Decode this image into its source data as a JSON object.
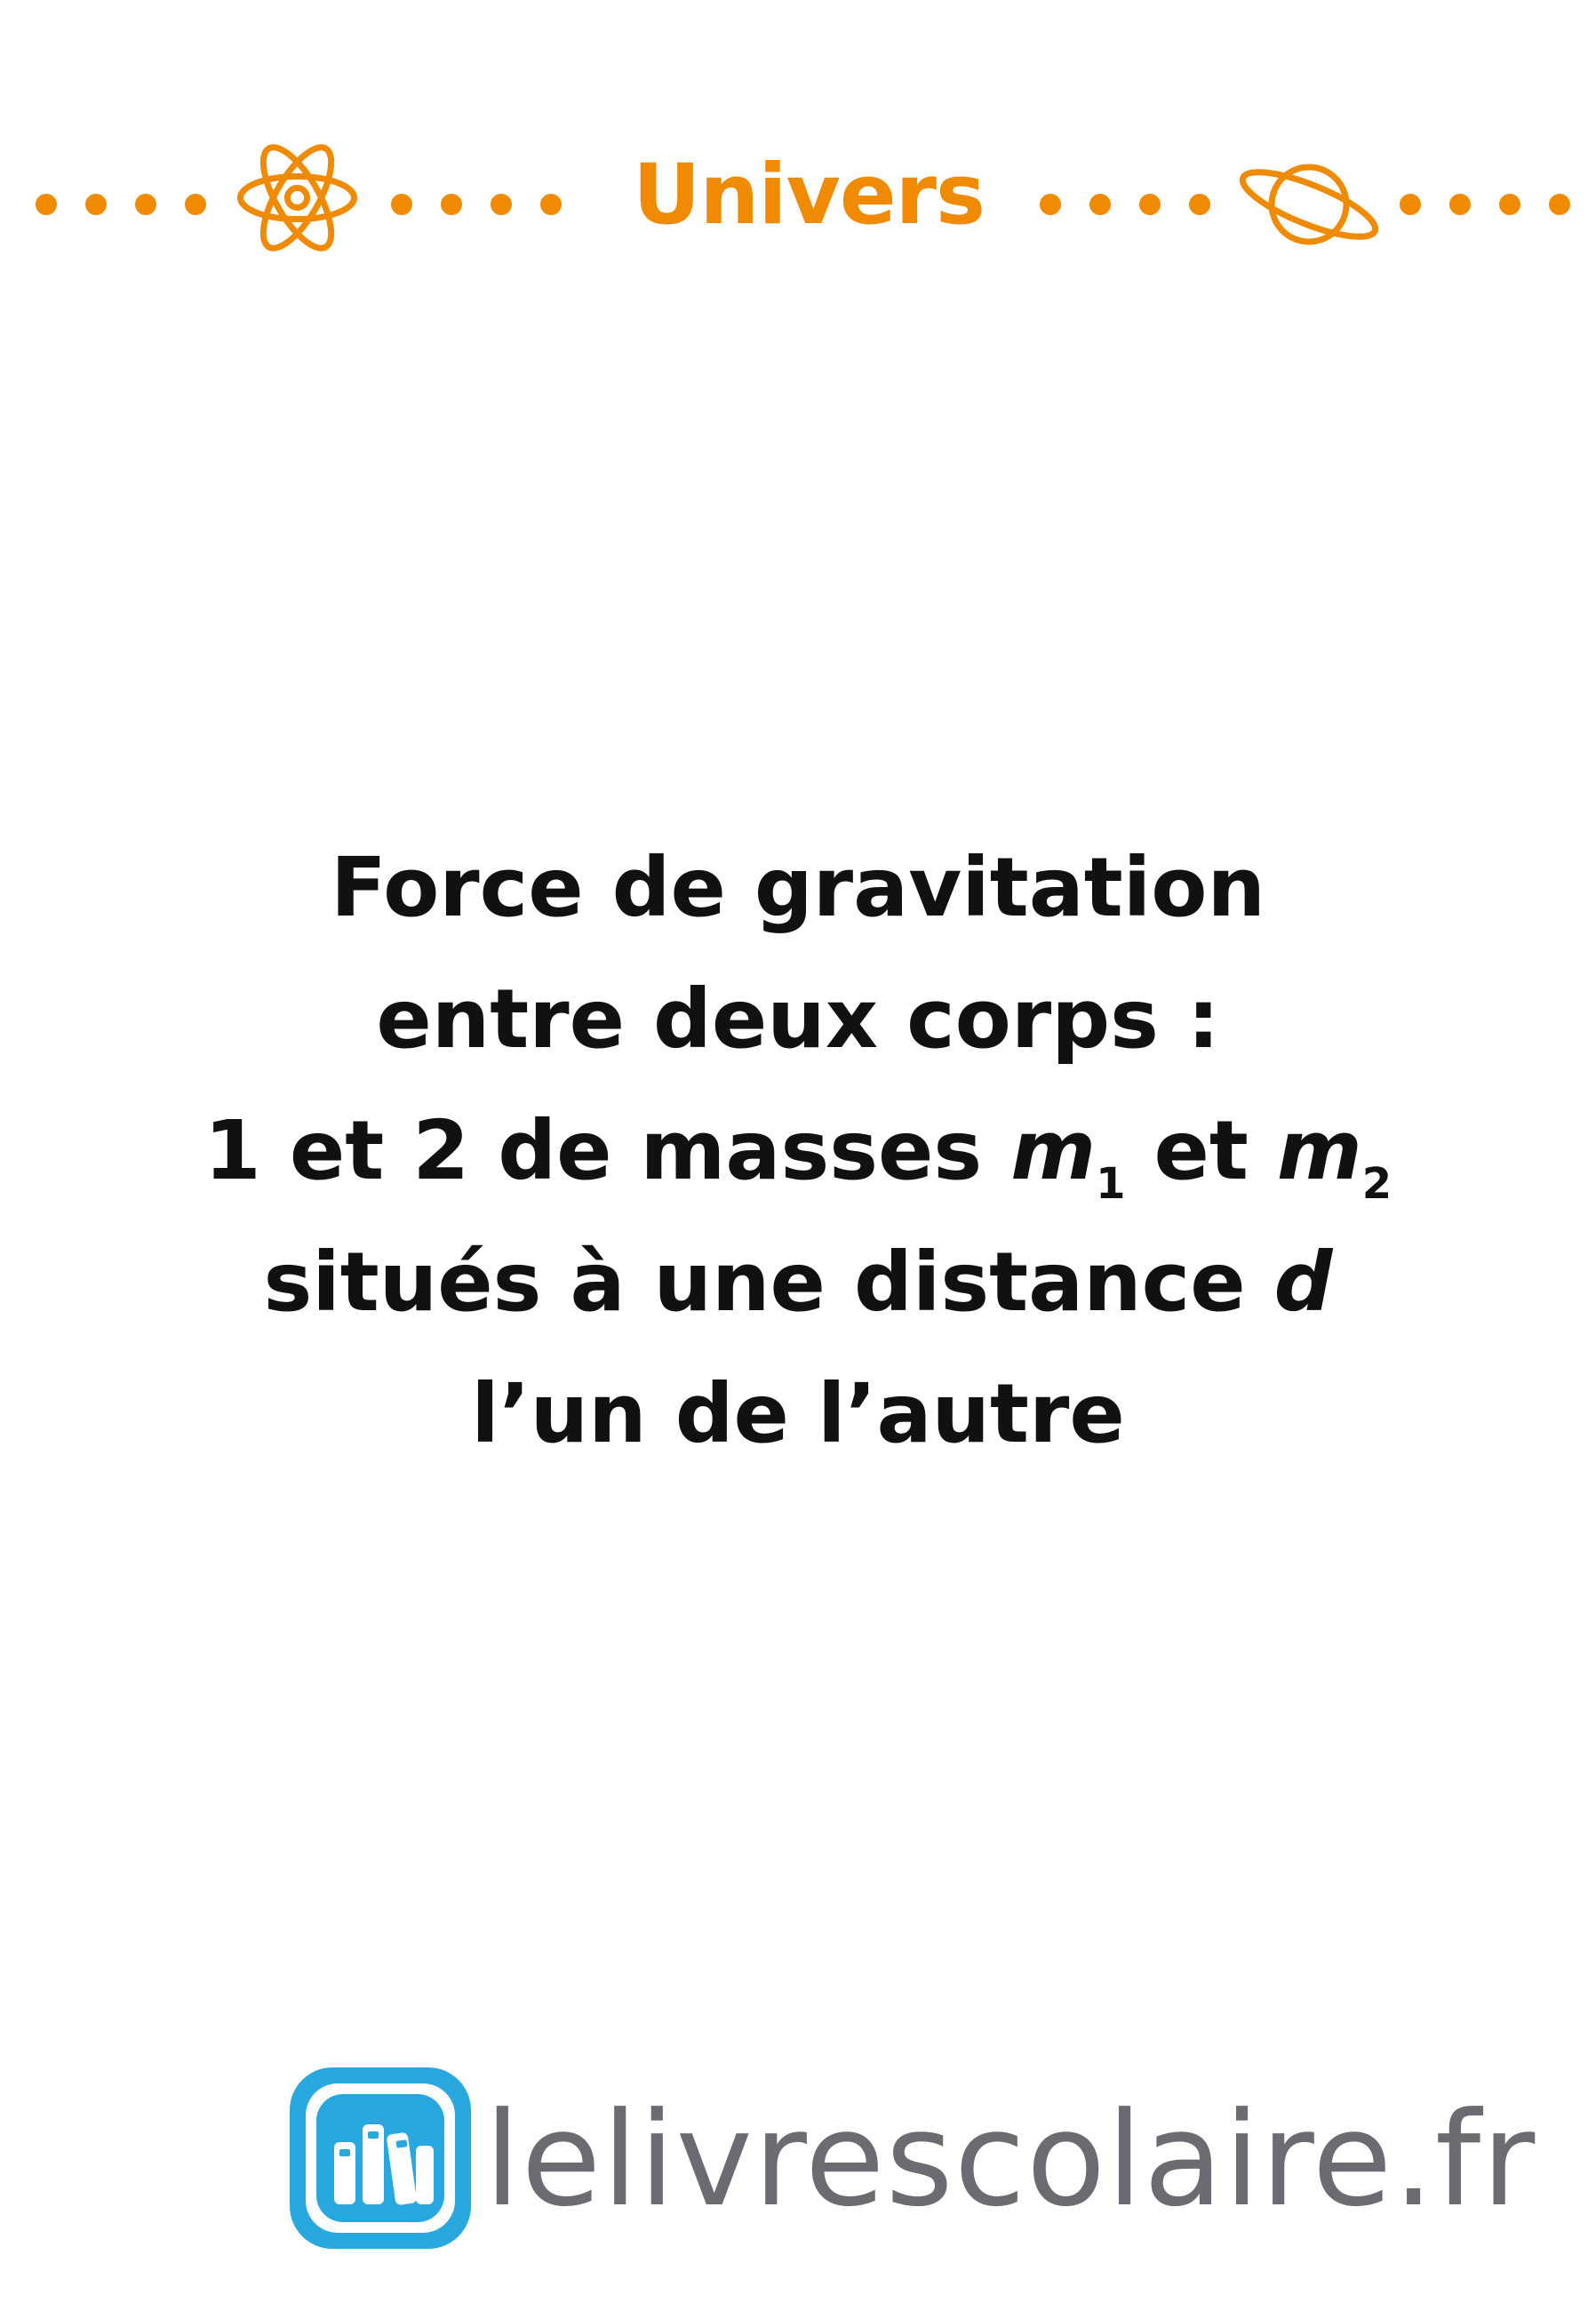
{
  "header": {
    "title": "Univers",
    "left_icon": "atom-icon",
    "right_icon": "planet-icon",
    "accent_color": "#f08a00"
  },
  "card": {
    "line1": "Force de gravitation",
    "line2": "entre deux corps :",
    "line3_prefix": "1 et 2 de masses ",
    "var_m": "m",
    "sub_1": "1",
    "line3_mid": " et ",
    "sub_2": "2",
    "line4_prefix": "situés à une distance ",
    "var_d": "d",
    "line5": "l’un de l’autre"
  },
  "footer": {
    "brand": "lelivrescolaire.fr",
    "logo_icon": "books-logo-icon",
    "logo_color": "#29a8e0"
  }
}
